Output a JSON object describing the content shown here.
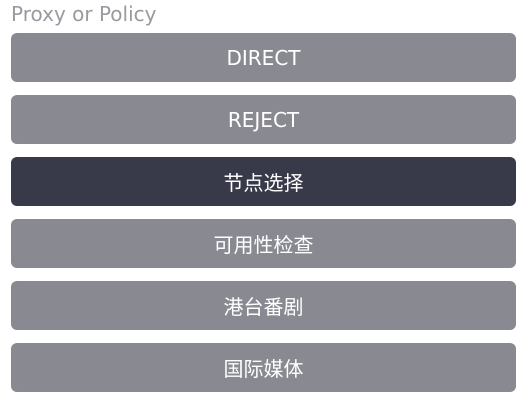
{
  "section": {
    "title": "Proxy or Policy"
  },
  "options": [
    {
      "label": "DIRECT",
      "selected": false
    },
    {
      "label": "REJECT",
      "selected": false
    },
    {
      "label": "节点选择",
      "selected": true
    },
    {
      "label": "可用性检查",
      "selected": false
    },
    {
      "label": "港台番剧",
      "selected": false
    },
    {
      "label": "国际媒体",
      "selected": false
    }
  ],
  "colors": {
    "option_default": "#898991",
    "option_selected": "#383a4a",
    "option_text": "#ffffff",
    "title_text": "#9a9aa0"
  }
}
